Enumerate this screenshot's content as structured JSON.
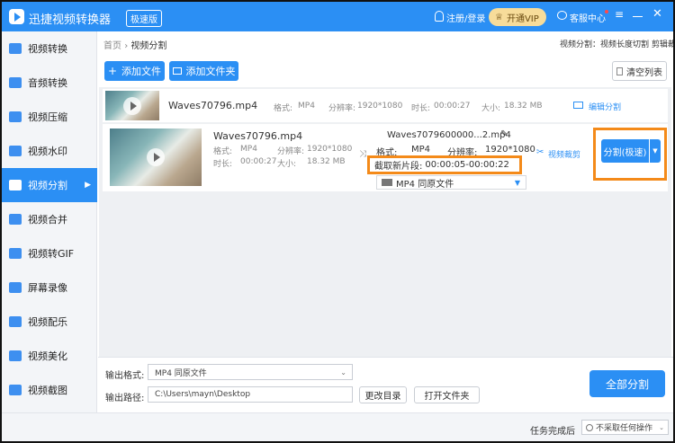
{
  "titlebar": {
    "app_name": "迅捷视频转换器",
    "edition_badge": "极速版",
    "login": "注册/登录",
    "vip": "开通VIP",
    "service": "客服中心"
  },
  "breadcrumb": {
    "home": "首页",
    "current": "视频分割",
    "right_text": "视频分割：视频长度切割 剪辑裁剪"
  },
  "toolbar": {
    "add_file": "添加文件",
    "add_folder": "添加文件夹",
    "clear_list": "清空列表"
  },
  "sidebar": {
    "items": [
      {
        "label": "视频转换",
        "icon": "video-convert-icon"
      },
      {
        "label": "音频转换",
        "icon": "audio-convert-icon"
      },
      {
        "label": "视频压缩",
        "icon": "compress-icon"
      },
      {
        "label": "视频水印",
        "icon": "watermark-icon"
      },
      {
        "label": "视频分割",
        "icon": "split-icon",
        "active": true
      },
      {
        "label": "视频合并",
        "icon": "merge-icon"
      },
      {
        "label": "视频转GIF",
        "icon": "gif-icon"
      },
      {
        "label": "屏幕录像",
        "icon": "record-icon"
      },
      {
        "label": "视频配乐",
        "icon": "music-icon"
      },
      {
        "label": "视频美化",
        "icon": "beautify-icon"
      },
      {
        "label": "视频截图",
        "icon": "screenshot-icon"
      }
    ]
  },
  "row1": {
    "filename": "Waves70796.mp4",
    "format_label": "格式:",
    "format": "MP4",
    "res_label": "分辨率:",
    "resolution": "1920*1080",
    "dur_label": "时长:",
    "duration": "00:00:27",
    "size_label": "大小:",
    "size": "18.32 MB",
    "edit_split": "编辑分割"
  },
  "row2": {
    "filename": "Waves70796.mp4",
    "format_label": "格式:",
    "format": "MP4",
    "res_label": "分辨率:",
    "resolution": "1920*1080",
    "dur_label": "时长:",
    "duration": "00:00:27",
    "size_label": "大小:",
    "size": "18.32 MB",
    "out_filename": "Waves7079600000...2.mp4",
    "out_format_label": "格式:",
    "out_format": "MP4",
    "out_res_label": "分辨率:",
    "out_resolution": "1920*1080",
    "clip_label": "截取新片段:",
    "clip_range": "00:00:05-00:00:22",
    "select_value": "MP4  同原文件",
    "video_crop": "视频裁剪",
    "split_button": "分割(极速)"
  },
  "footer": {
    "out_format_label": "输出格式:",
    "out_format_value": "MP4  同原文件",
    "out_path_label": "输出路径:",
    "out_path_value": "C:\\Users\\mayn\\Desktop",
    "change_dir": "更改目录",
    "open_folder": "打开文件夹",
    "split_all": "全部分割",
    "task_done_label": "任务完成后",
    "task_done_value": "不采取任何操作"
  },
  "colors": {
    "accent": "#2b8ff4",
    "highlight": "#f48a19"
  }
}
